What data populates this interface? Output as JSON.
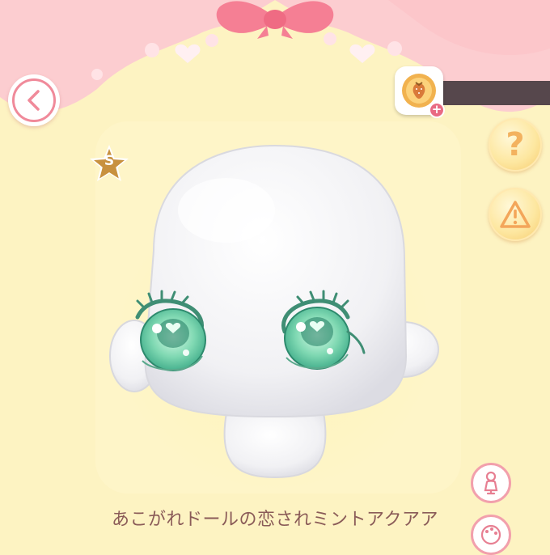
{
  "header": {
    "back_icon": "chevron-left-icon",
    "currency": {
      "icon": "strawberry-coin-icon",
      "amount": "",
      "add_icon": "plus-icon"
    }
  },
  "side_buttons": {
    "help_label": "?",
    "warning_icon": "warning-icon",
    "action1_icon": "mannequin-icon",
    "action2_icon": "color-palette-icon"
  },
  "item": {
    "rarity": "S",
    "name": "あこがれドールの恋されミントアクアア"
  },
  "colors": {
    "background": "#fdf3c2",
    "curtain": "#fccdd0",
    "ribbon": "#f57f94",
    "eye": "#5fc9a6",
    "text": "#8a5b58"
  }
}
